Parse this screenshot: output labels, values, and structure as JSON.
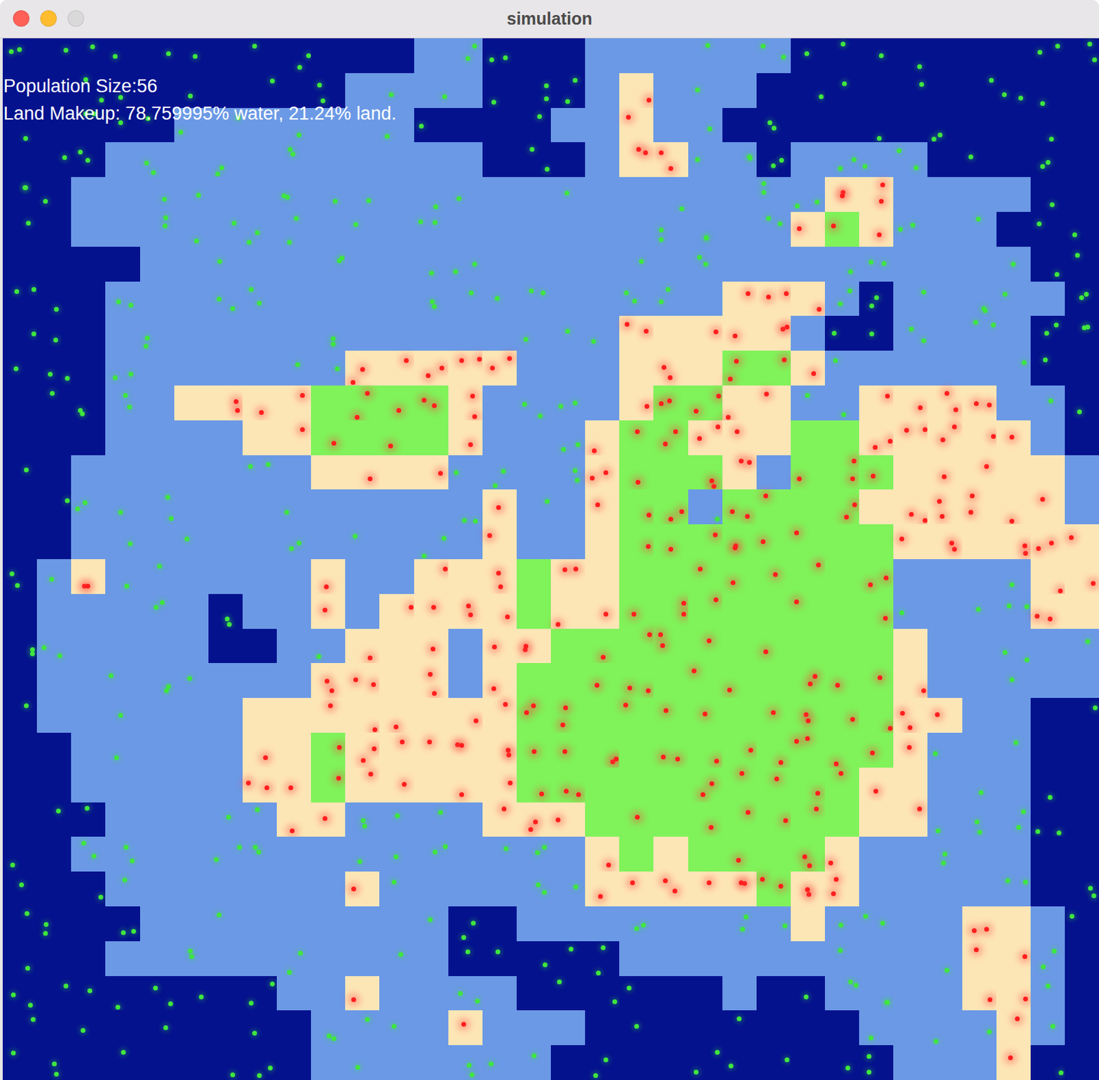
{
  "window": {
    "title": "simulation",
    "buttons": [
      {
        "name": "close",
        "color": "#fe5f57"
      },
      {
        "name": "minimize",
        "color": "#febc2e"
      },
      {
        "name": "zoom",
        "color": "#d9d9d9"
      }
    ]
  },
  "overlay": {
    "lines": [
      "Population Size:56",
      "Land Makeup: 78.759995% water, 21.24% land."
    ]
  },
  "terrain_kinds": [
    {
      "key": "D",
      "name": "deep water",
      "color": "#05128e",
      "dot": "#3fe63f"
    },
    {
      "key": "W",
      "name": "shallow water",
      "color": "#6b99e6",
      "dot": "#3fe63f"
    },
    {
      "key": "S",
      "name": "sand",
      "color": "#fde6b6",
      "dot": "#ff1e1e"
    },
    {
      "key": "G",
      "name": "grass",
      "color": "#80f25a",
      "dot": "#ff1e1e"
    }
  ],
  "map": {
    "rows": [
      "DDDDDDDDDDDDWWDDDWWWWWWDDDDDDDDD",
      "DDDDDDDDDDWWWWDDDWSWWWDDDDDDDDDD",
      "DDDDDWWWWWWWDDDDWWSWWDDDDDDDDDDD",
      "DDDWWWWWWWWWWWDDDWSSWWDWWWWDDDDD",
      "DDWWWWWWWWWWWWWWWWWWWWWWSSWWWWDD",
      "DDWWWWWWWWWWWWWWWWWWWWWSGSWWWDDD",
      "DDDDWWWWWWWWWWWWWWWWWWWWWWWWWWDD",
      "DDDWWWWWWWWWWWWWWWWWWSSSWDWWWWWD",
      "DDDWWWWWWWWWWWWWWWSSSSSWDDWWWWDD",
      "DDDWWWWWWWSSSSSWWWSSSGGSWWWWWWDD",
      "DDDWWSSSSGGGGSWWWWSGGSSWWSSSSWWD",
      "DDDWWWWSSGGGGSWWWSGGSSSGGSSSSSWD",
      "DDWWWWWWWSSSSWWWWSGGGSWGGGSSSSSW",
      "DDWWWWWWWWWWWWSWWSGGWGGGGSSSSSSW",
      "DDWWWWWWWWWWWWSWWSGGGGGGGGSSSSSS",
      "DWSWWWWWWSWWSSSGSSGGGGGGGGWWWWSS",
      "DWWWWWDWWSWSSSSGSSGGGGGGGGWWWWSS",
      "DWWWWWDDWWSSSWSSGGGGGGGGGGSWWWWW",
      "DWWWWWWWWSSSSWSGGGGGGGGGGGSWWWWW",
      "DWWWWWWSSSSSSSSGGGGGGGGGGGSSWWDD",
      "DDWWWWWSSGSSSSSGGGGGGGGGGGSWWWDD",
      "DDWWWWWSSGSSSSSGGGGGGGGGGSSWWWDD",
      "DDDWWWWWSSWWWWSSSGGGGGGGGSSWWWDD",
      "DDWWWWWWWWWWWWWWWSGSGGGGSWWWWWDD",
      "DDDWWWWWWWSWWWWWWSSSSSGSSWWWWWDD",
      "DDDDWWWWWWWWWDDWWWWWWWWSWWWWSSWD",
      "DDDWWWWWWWWWWDDDDDWWWWWWWWWWSSWD",
      "DDDDDDDDWWSWWWWDDDDDDWDDWWWWSSWD",
      "DDDDDDDDDWWWWSWWWDDDDDDDDWWWWSWD",
      "DDDDDDDDDWWWWWWWDDDDDDDDDDWWWSDD"
    ]
  }
}
